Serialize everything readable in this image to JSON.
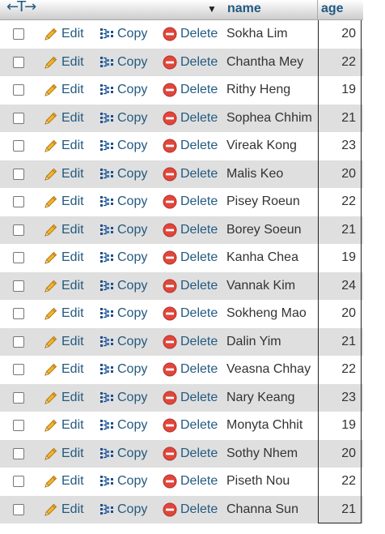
{
  "header": {
    "arrows_glyph": "←T→",
    "sort_glyph": "▼",
    "name_label": "name",
    "age_label": "age"
  },
  "actions": {
    "edit_label": "Edit",
    "copy_label": "Copy",
    "delete_label": "Delete",
    "edit_icon": "pencil-icon",
    "copy_icon": "copy-icon",
    "delete_icon": "delete-icon"
  },
  "colors": {
    "link": "#235a81",
    "row_alt": "#dfdfdf",
    "delete_icon": "#e0473c",
    "pencil": "#e8a320"
  },
  "rows": [
    {
      "name": "Sokha Lim",
      "age": "20"
    },
    {
      "name": "Chantha Mey",
      "age": "22"
    },
    {
      "name": "Rithy Heng",
      "age": "19"
    },
    {
      "name": "Sophea Chhim",
      "age": "21"
    },
    {
      "name": "Vireak Kong",
      "age": "23"
    },
    {
      "name": "Malis Keo",
      "age": "20"
    },
    {
      "name": "Pisey Roeun",
      "age": "22"
    },
    {
      "name": "Borey Soeun",
      "age": "21"
    },
    {
      "name": "Kanha Chea",
      "age": "19"
    },
    {
      "name": "Vannak Kim",
      "age": "24"
    },
    {
      "name": "Sokheng Mao",
      "age": "20"
    },
    {
      "name": "Dalin Yim",
      "age": "21"
    },
    {
      "name": "Veasna Chhay",
      "age": "22"
    },
    {
      "name": "Nary Keang",
      "age": "23"
    },
    {
      "name": "Monyta Chhit",
      "age": "19"
    },
    {
      "name": "Sothy Nhem",
      "age": "20"
    },
    {
      "name": "Piseth Nou",
      "age": "22"
    },
    {
      "name": "Channa Sun",
      "age": "21"
    }
  ]
}
